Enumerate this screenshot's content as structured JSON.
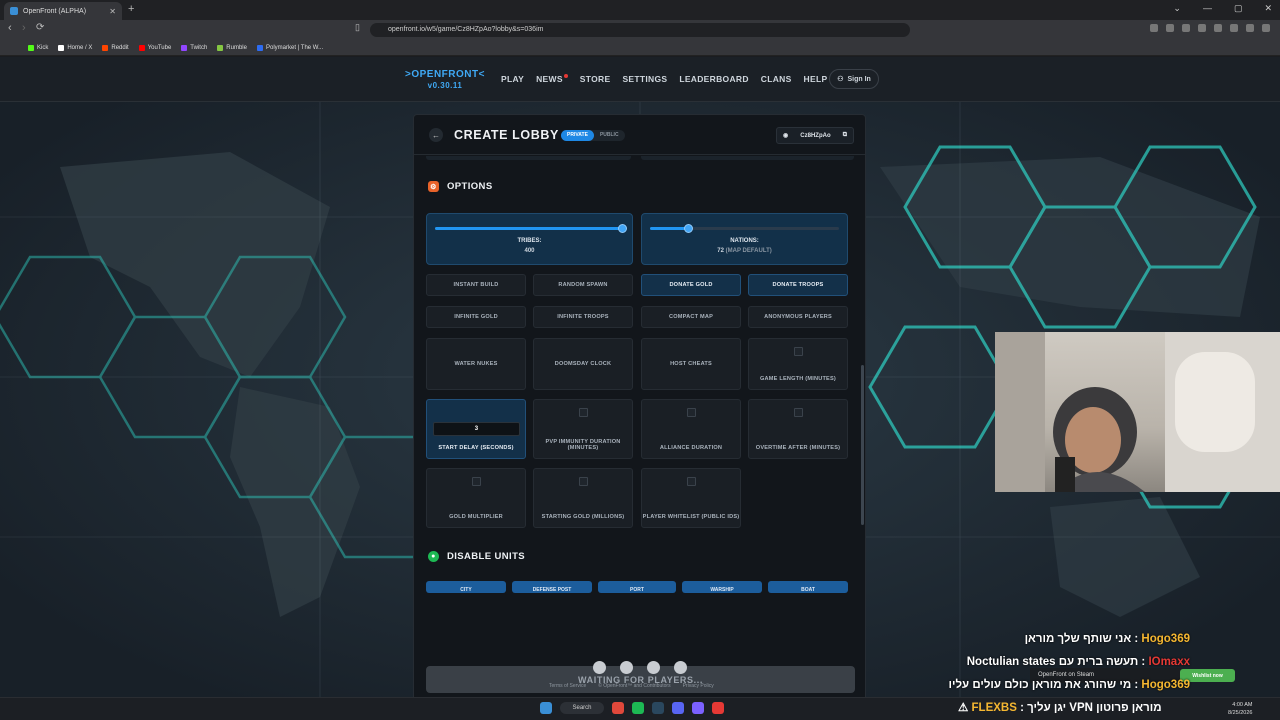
{
  "browser": {
    "tab_title": "OpenFront (ALPHA)",
    "url": "openfront.io/w5/game/Cz8HZpAo?lobby&s=036im",
    "bookmarks": [
      {
        "label": "Kick",
        "color": "#53fc18"
      },
      {
        "label": "Home / X",
        "color": "#ffffff"
      },
      {
        "label": "Reddit",
        "color": "#ff4500"
      },
      {
        "label": "YouTube",
        "color": "#ff0000"
      },
      {
        "label": "Twitch",
        "color": "#9146ff"
      },
      {
        "label": "Rumble",
        "color": "#85c742"
      },
      {
        "label": "Polymarket | The W...",
        "color": "#2d6cf2"
      }
    ]
  },
  "site": {
    "logo": ">OPENFRONT<",
    "version": "v0.30.11",
    "nav": [
      "PLAY",
      "NEWS",
      "STORE",
      "SETTINGS",
      "LEADERBOARD",
      "CLANS",
      "HELP"
    ],
    "signin": "Sign In"
  },
  "modal": {
    "title": "CREATE LOBBY",
    "mode_private": "PRIVATE",
    "mode_public": "PUBLIC",
    "lobby_id": "Cz8HZpAo",
    "options_title": "OPTIONS",
    "tribes_label": "TRIBES:",
    "tribes_value": "400",
    "tribes_fraction": 0.99,
    "nations_label": "NATIONS:",
    "nations_value": "72",
    "nations_note": "(MAP DEFAULT)",
    "nations_fraction": 0.2,
    "toggles": [
      {
        "label": "INSTANT BUILD",
        "active": false
      },
      {
        "label": "RANDOM SPAWN",
        "active": false
      },
      {
        "label": "DONATE GOLD",
        "active": true
      },
      {
        "label": "DONATE TROOPS",
        "active": true
      },
      {
        "label": "INFINITE GOLD",
        "active": false
      },
      {
        "label": "INFINITE TROOPS",
        "active": false
      },
      {
        "label": "COMPACT MAP",
        "active": false
      },
      {
        "label": "ANONYMOUS PLAYERS",
        "active": false
      },
      {
        "label": "WATER NUKES",
        "active": false
      },
      {
        "label": "DOOMSDAY CLOCK",
        "active": false
      },
      {
        "label": "HOST CHEATS",
        "active": false
      }
    ],
    "game_length": "GAME LENGTH (MINUTES)",
    "start_delay_value": "3",
    "start_delay": "START DELAY (SECONDS)",
    "pvp_immunity": "PVP IMMUNITY DURATION (MINUTES)",
    "alliance_duration": "ALLIANCE DURATION",
    "overtime": "OVERTIME AFTER (MINUTES)",
    "gold_multiplier": "GOLD MULTIPLIER",
    "starting_gold": "STARTING GOLD (MILLIONS)",
    "player_whitelist": "PLAYER WHITELIST (PUBLIC IDS)",
    "disable_units_title": "DISABLE UNITS",
    "units": [
      "CITY",
      "DEFENSE POST",
      "PORT",
      "WARSHIP",
      "BOAT"
    ],
    "waiting": "WAITING FOR PLAYERS..."
  },
  "footer": {
    "links": [
      "Terms of Service",
      "© OpenFront™ and Contributors",
      "Privacy Policy"
    ]
  },
  "stream": {
    "steam_tag": "OpenFront on Steam",
    "wishlist": "Wishlist now",
    "chat": [
      {
        "user": "Hogo369",
        "msg": "אני שותף שלך מוראן",
        "red": false
      },
      {
        "user": "IOmaxx",
        "msg": "Noctulian states תעשה ברית עם",
        "red": true
      },
      {
        "user": "Hogo369",
        "msg": "מי שהורג את מוראן כולם עולים עליו",
        "red": false
      }
    ],
    "bottom_user": "FLEXBS",
    "bottom_msg": "יגן עליך VPN מוראן פרוטון"
  },
  "taskbar": {
    "search": "Search",
    "time": "4:00 AM",
    "date": "8/25/2026"
  }
}
